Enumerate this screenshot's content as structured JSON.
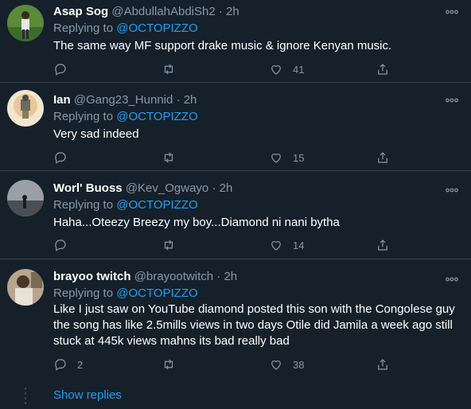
{
  "tweets": [
    {
      "name": "Asap Sog",
      "handle": "@AbdullahAbdiSh2",
      "sep": "·",
      "time": "2h",
      "replying_prefix": "Replying to",
      "replying_to": "@OCTOPIZZO",
      "text": "The same way MF support drake music & ignore Kenyan music.",
      "replies": "",
      "retweets": "",
      "likes": "41"
    },
    {
      "name": "Ian",
      "handle": "@Gang23_Hunnid",
      "sep": "·",
      "time": "2h",
      "replying_prefix": "Replying to",
      "replying_to": "@OCTOPIZZO",
      "text": "Very sad indeed",
      "replies": "",
      "retweets": "",
      "likes": "15"
    },
    {
      "name": "Worl' Buoss",
      "handle": "@Kev_Ogwayo",
      "sep": "·",
      "time": "2h",
      "replying_prefix": "Replying to",
      "replying_to": "@OCTOPIZZO",
      "text": "Haha...Oteezy Breezy my boy...Diamond ni nani bytha",
      "replies": "",
      "retweets": "",
      "likes": "14"
    },
    {
      "name": "brayoo twitch",
      "handle": "@brayootwitch",
      "sep": "·",
      "time": "2h",
      "replying_prefix": "Replying to",
      "replying_to": "@OCTOPIZZO",
      "text": "Like I just saw on YouTube diamond posted this son with the Congolese guy the song has like 2.5mills views in two days Otile did Jamila a week ago still stuck at 445k views mahns its bad really bad",
      "replies": "2",
      "retweets": "",
      "likes": "38"
    }
  ],
  "more_glyph": "ooo",
  "show_replies": "Show replies",
  "icons": [
    "reply-icon",
    "retweet-icon",
    "like-icon",
    "share-icon",
    "more-icon"
  ],
  "colors": {
    "background": "#15202b",
    "divider": "#38444d",
    "secondary_text": "#8899a6",
    "link": "#1da1f2"
  }
}
